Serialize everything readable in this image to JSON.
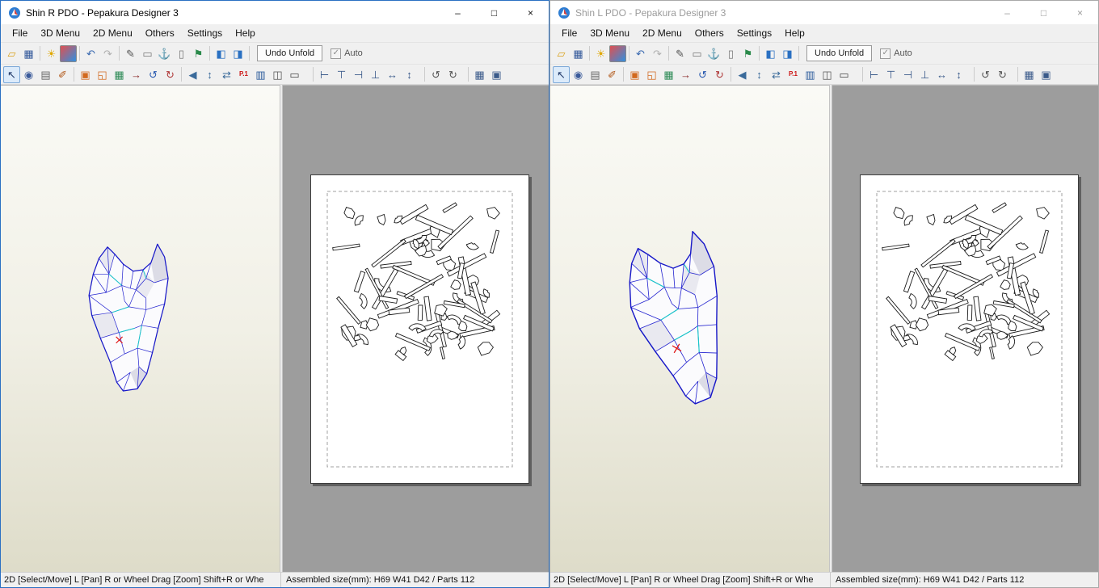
{
  "windows": [
    {
      "title": "Shin R PDO - Pepakura Designer 3",
      "state": "active"
    },
    {
      "title": "Shin L PDO - Pepakura Designer 3",
      "state": "inactive"
    }
  ],
  "window_controls": {
    "minimize": "–",
    "maximize": "□",
    "close": "×"
  },
  "menu": {
    "items": [
      "File",
      "3D Menu",
      "2D Menu",
      "Others",
      "Settings",
      "Help"
    ]
  },
  "toolbar_main": {
    "undo_unfold_label": "Undo Unfold",
    "auto_label": "Auto",
    "auto_checked": true,
    "icons": [
      {
        "name": "open-file",
        "glyph": "▱",
        "color": "#d8a018"
      },
      {
        "name": "save-file",
        "glyph": "▦",
        "color": "#33589a"
      },
      {
        "sep": true
      },
      {
        "name": "light-toggle",
        "glyph": "☀",
        "color": "#e0a800"
      },
      {
        "name": "textured-display",
        "glyph": "",
        "color": "#ffffff",
        "bg": "#e05050",
        "bg2": "#3090e0"
      },
      {
        "sep": true
      },
      {
        "name": "undo",
        "glyph": "↶",
        "color": "#3a6ab0"
      },
      {
        "name": "redo",
        "glyph": "↷",
        "color": "#b0b0b0"
      },
      {
        "sep": true
      },
      {
        "name": "pen",
        "glyph": "✎",
        "color": "#555555"
      },
      {
        "name": "stamp",
        "glyph": "▭",
        "color": "#777777"
      },
      {
        "name": "anchor",
        "glyph": "⚓",
        "color": "#3a5a8a"
      },
      {
        "name": "column",
        "glyph": "▯",
        "color": "#777777"
      },
      {
        "name": "magnet",
        "glyph": "⚑",
        "color": "#2a8a4a"
      },
      {
        "sep": true
      },
      {
        "name": "show-3d-window",
        "glyph": "◧",
        "color": "#2a70c2"
      },
      {
        "name": "show-2d-window",
        "glyph": "◨",
        "color": "#2a70c2"
      },
      {
        "sep": true
      }
    ]
  },
  "toolbar_2d": {
    "icons": [
      {
        "name": "select-parts",
        "glyph": "↖",
        "color": "#223a6a",
        "active": true
      },
      {
        "name": "edit-points",
        "glyph": "◉",
        "color": "#3a5a9a"
      },
      {
        "name": "film-strip",
        "glyph": "▤",
        "color": "#666666"
      },
      {
        "name": "paint",
        "glyph": "✐",
        "color": "#b05515"
      },
      {
        "sep": true
      },
      {
        "name": "join-parts",
        "glyph": "▣",
        "color": "#d2691e"
      },
      {
        "name": "split-parts",
        "glyph": "◱",
        "color": "#d2691e"
      },
      {
        "name": "insert-image",
        "glyph": "▦",
        "color": "#2e8b57"
      },
      {
        "name": "export-image",
        "glyph": "→",
        "color": "#8a2a2a"
      },
      {
        "name": "rotate-left",
        "glyph": "↺",
        "color": "#2a5ab0"
      },
      {
        "name": "rotate-right",
        "glyph": "↻",
        "color": "#b03a3a"
      },
      {
        "sep": true
      },
      {
        "name": "open-edge",
        "glyph": "◀",
        "color": "#3a6a9a"
      },
      {
        "name": "scale-parts",
        "glyph": "↕",
        "color": "#3a6a9a"
      },
      {
        "name": "spread-sheets",
        "glyph": "⇄",
        "color": "#3a6a9a"
      },
      {
        "name": "page-number",
        "glyph": "P.1",
        "color": "#cc1111"
      },
      {
        "name": "sheet-info",
        "glyph": "▥",
        "color": "#2a5a9a"
      },
      {
        "name": "print-preview",
        "glyph": "◫",
        "color": "#555555"
      },
      {
        "name": "print",
        "glyph": "▭",
        "color": "#444444"
      },
      {
        "sep": true,
        "gap": 12
      },
      {
        "name": "align-left",
        "glyph": "⊢",
        "color": "#3a5a8a"
      },
      {
        "name": "align-top",
        "glyph": "⊤",
        "color": "#3a5a8a"
      },
      {
        "name": "align-right",
        "glyph": "⊣",
        "color": "#3a5a8a"
      },
      {
        "name": "align-bottom",
        "glyph": "⊥",
        "color": "#3a5a8a"
      },
      {
        "name": "distribute-horizontal",
        "glyph": "↔",
        "color": "#3a5a8a"
      },
      {
        "name": "distribute-vertical",
        "glyph": "↕",
        "color": "#3a5a8a"
      },
      {
        "sep": true,
        "gap": 8
      },
      {
        "name": "rotate-90-ccw",
        "glyph": "↺",
        "color": "#555555"
      },
      {
        "name": "rotate-90-cw",
        "glyph": "↻",
        "color": "#555555"
      },
      {
        "sep": true,
        "gap": 8
      },
      {
        "name": "auto-layout",
        "glyph": "▦",
        "color": "#3a5a8a"
      },
      {
        "name": "fit-to-page",
        "glyph": "▣",
        "color": "#3a5a8a"
      }
    ]
  },
  "statusbar": {
    "mode_hint": "2D [Select/Move] L [Pan] R or Wheel Drag [Zoom] Shift+R or Whe",
    "assembled_info": "Assembled size(mm): H69 W41 D42 / Parts 112"
  },
  "colors": {
    "accent": "#2a70c2",
    "wire_blue": "#2222cf",
    "wire_outline": "#1717c8",
    "wire_cyan": "#17c8c8",
    "marker_red": "#e01212",
    "part_stroke": "#1a1a1a",
    "pane2d_bg": "#9d9d9d"
  }
}
